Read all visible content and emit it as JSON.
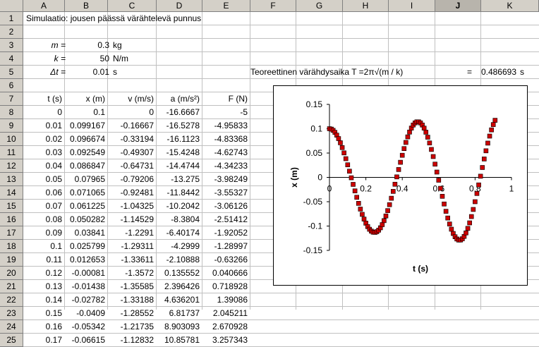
{
  "columns": [
    "A",
    "B",
    "C",
    "D",
    "E",
    "F",
    "G",
    "H",
    "I",
    "J",
    "K"
  ],
  "selected_column": "J",
  "rows": [
    "1",
    "2",
    "3",
    "4",
    "5",
    "6",
    "7",
    "8",
    "9",
    "10",
    "11",
    "12",
    "13",
    "14",
    "15",
    "16",
    "17",
    "18",
    "19",
    "20",
    "21",
    "22",
    "23",
    "24",
    "25"
  ],
  "title": "Simulaatio: jousen päässä värähtelevä punnus",
  "params": [
    {
      "label": "m =",
      "value": "0.3",
      "unit": "kg"
    },
    {
      "label": "k =",
      "value": "50",
      "unit": "N/m"
    },
    {
      "label": "Δt =",
      "value": "0.01",
      "unit": "s"
    }
  ],
  "theory": {
    "label": "Teoreettinen värähdysaika  T =2π√(m / k)",
    "eq": "=",
    "value": "0.486693",
    "unit": "s"
  },
  "table_headers": [
    "t (s)",
    "x (m)",
    "v (m/s)",
    "a (m/s²)",
    "F (N)"
  ],
  "table_rows": [
    [
      "0",
      "0.1",
      "0",
      "-16.6667",
      "-5"
    ],
    [
      "0.01",
      "0.099167",
      "-0.16667",
      "-16.5278",
      "-4.95833"
    ],
    [
      "0.02",
      "0.096674",
      "-0.33194",
      "-16.1123",
      "-4.83368"
    ],
    [
      "0.03",
      "0.092549",
      "-0.49307",
      "-15.4248",
      "-4.62743"
    ],
    [
      "0.04",
      "0.086847",
      "-0.64731",
      "-14.4744",
      "-4.34233"
    ],
    [
      "0.05",
      "0.07965",
      "-0.79206",
      "-13.275",
      "-3.98249"
    ],
    [
      "0.06",
      "0.071065",
      "-0.92481",
      "-11.8442",
      "-3.55327"
    ],
    [
      "0.07",
      "0.061225",
      "-1.04325",
      "-10.2042",
      "-3.06126"
    ],
    [
      "0.08",
      "0.050282",
      "-1.14529",
      "-8.3804",
      "-2.51412"
    ],
    [
      "0.09",
      "0.03841",
      "-1.2291",
      "-6.40174",
      "-1.92052"
    ],
    [
      "0.1",
      "0.025799",
      "-1.29311",
      "-4.2999",
      "-1.28997"
    ],
    [
      "0.11",
      "0.012653",
      "-1.33611",
      "-2.10888",
      "-0.63266"
    ],
    [
      "0.12",
      "-0.00081",
      "-1.3572",
      "0.135552",
      "0.040666"
    ],
    [
      "0.13",
      "-0.01438",
      "-1.35585",
      "2.396426",
      "0.718928"
    ],
    [
      "0.14",
      "-0.02782",
      "-1.33188",
      "4.636201",
      "1.39086"
    ],
    [
      "0.15",
      "-0.0409",
      "-1.28552",
      "6.81737",
      "2.045211"
    ],
    [
      "0.16",
      "-0.05342",
      "-1.21735",
      "8.903093",
      "2.670928"
    ],
    [
      "0.17",
      "-0.06615",
      "-1.12832",
      "10.85781",
      "3.257343"
    ]
  ],
  "chart_data": {
    "type": "scatter",
    "title": "",
    "xlabel": "t (s)",
    "ylabel": "x (m)",
    "xlim": [
      0,
      1
    ],
    "ylim": [
      -0.15,
      0.15
    ],
    "xticks": [
      "0",
      "0.2",
      "0.4",
      "0.6",
      "0.8",
      "1"
    ],
    "yticks": [
      "0.15",
      "0.1",
      "0.05",
      "0",
      "-0.05",
      "-0.1",
      "-0.15"
    ],
    "marker_color": "#cc0000",
    "series": [
      {
        "x": [
          0,
          0.01,
          0.02,
          0.03,
          0.04,
          0.05,
          0.06,
          0.07,
          0.08,
          0.09,
          0.1,
          0.11,
          0.12,
          0.13,
          0.14,
          0.15,
          0.16,
          0.17,
          0.18,
          0.19,
          0.2,
          0.21,
          0.22,
          0.23,
          0.24,
          0.25,
          0.26,
          0.27,
          0.28,
          0.29,
          0.3,
          0.31,
          0.32,
          0.33,
          0.34,
          0.35,
          0.36,
          0.37,
          0.38,
          0.39,
          0.4,
          0.41,
          0.42,
          0.43,
          0.44,
          0.45,
          0.46,
          0.47,
          0.48,
          0.49,
          0.5,
          0.51,
          0.52,
          0.53,
          0.54,
          0.55,
          0.56,
          0.57,
          0.58,
          0.59,
          0.6,
          0.61,
          0.62,
          0.63,
          0.64,
          0.65,
          0.66,
          0.67,
          0.68,
          0.69,
          0.7,
          0.71,
          0.72,
          0.73,
          0.74,
          0.75,
          0.76,
          0.77,
          0.78,
          0.79,
          0.8,
          0.81,
          0.82,
          0.83,
          0.84,
          0.85,
          0.86,
          0.87,
          0.88,
          0.89,
          0.9,
          0.91
        ],
        "y": [
          0.1,
          0.0992,
          0.0967,
          0.0925,
          0.0868,
          0.0797,
          0.0711,
          0.0612,
          0.0503,
          0.0384,
          0.0258,
          0.0127,
          -0.0008,
          -0.0144,
          -0.0278,
          -0.0409,
          -0.0534,
          -0.0652,
          -0.076,
          -0.0857,
          -0.0941,
          -0.1011,
          -0.1066,
          -0.1104,
          -0.1126,
          -0.113,
          -0.1116,
          -0.1085,
          -0.1036,
          -0.0971,
          -0.0889,
          -0.0793,
          -0.0683,
          -0.0561,
          -0.0429,
          -0.0288,
          -0.0141,
          0.001,
          0.0161,
          0.031,
          0.0454,
          0.0591,
          0.0718,
          0.0832,
          0.0931,
          0.1013,
          0.1076,
          0.1119,
          0.1141,
          0.1141,
          0.1119,
          0.1076,
          0.1012,
          0.0928,
          0.0826,
          0.0707,
          0.0574,
          0.0428,
          0.0272,
          0.0109,
          -0.0058,
          -0.0225,
          -0.0389,
          -0.0547,
          -0.0697,
          -0.0835,
          -0.0958,
          -0.1065,
          -0.1153,
          -0.122,
          -0.1266,
          -0.1288,
          -0.1287,
          -0.1262,
          -0.1213,
          -0.1141,
          -0.1048,
          -0.0935,
          -0.0805,
          -0.0659,
          -0.05,
          -0.0331,
          -0.0155,
          0.0024,
          0.0203,
          0.0378,
          0.0546,
          0.0704,
          0.0848,
          0.0976,
          0.1085,
          0.1173
        ]
      }
    ]
  }
}
